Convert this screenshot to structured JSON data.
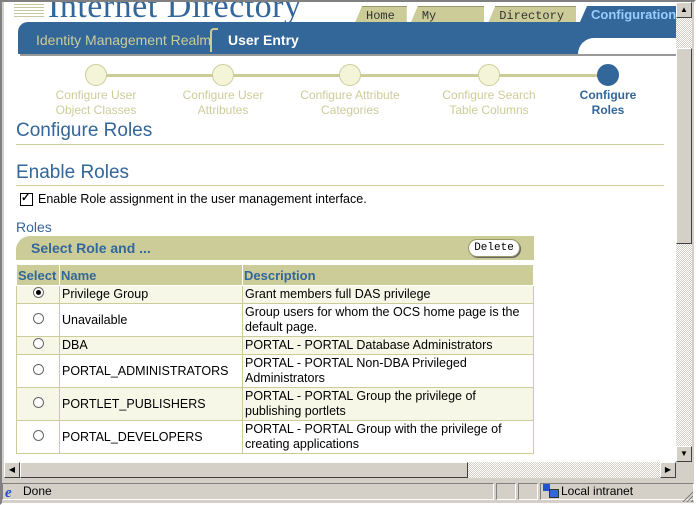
{
  "header": {
    "brand": "Internet Directory",
    "tabs": [
      "Home",
      "My Profile",
      "Directory",
      "Configuration"
    ],
    "active_tab": "Configuration",
    "subtabs": [
      "Identity Management Realm",
      "User Entry"
    ],
    "active_subtab": "User Entry"
  },
  "train": {
    "steps": [
      {
        "line1": "Configure User",
        "line2": "Object Classes",
        "state": "visited"
      },
      {
        "line1": "Configure User",
        "line2": "Attributes",
        "state": "visited"
      },
      {
        "line1": "Configure Attribute",
        "line2": "Categories",
        "state": "visited"
      },
      {
        "line1": "Configure Search",
        "line2": "Table Columns",
        "state": "visited"
      },
      {
        "line1": "Configure",
        "line2": "Roles",
        "state": "current"
      }
    ]
  },
  "page": {
    "title": "Configure Roles",
    "section_title": "Enable Roles",
    "checkbox_label": "Enable Role assignment in the user management interface.",
    "checkbox_checked": true,
    "roles_label": "Roles",
    "action_bar_title": "Select Role and ...",
    "delete_label": "Delete"
  },
  "table": {
    "columns": [
      "Select",
      "Name",
      "Description"
    ],
    "rows": [
      {
        "selected": true,
        "name": "Privilege Group",
        "description": "Grant members full DAS privilege"
      },
      {
        "selected": false,
        "name": "Unavailable",
        "description": "Group users for whom the OCS home page is the default page."
      },
      {
        "selected": false,
        "name": "DBA",
        "description": "PORTAL - PORTAL Database Administrators"
      },
      {
        "selected": false,
        "name": "PORTAL_ADMINISTRATORS",
        "description": "PORTAL - PORTAL Non-DBA Privileged Administrators"
      },
      {
        "selected": false,
        "name": "PORTLET_PUBLISHERS",
        "description": "PORTAL - PORTAL Group the privilege of publishing portlets"
      },
      {
        "selected": false,
        "name": "PORTAL_DEVELOPERS",
        "description": "PORTAL - PORTAL Group with the privilege of creating applications"
      }
    ]
  },
  "statusbar": {
    "status": "Done",
    "zone": "Local intranet"
  },
  "colors": {
    "brand_blue": "#336699",
    "tan": "#cccc99"
  }
}
